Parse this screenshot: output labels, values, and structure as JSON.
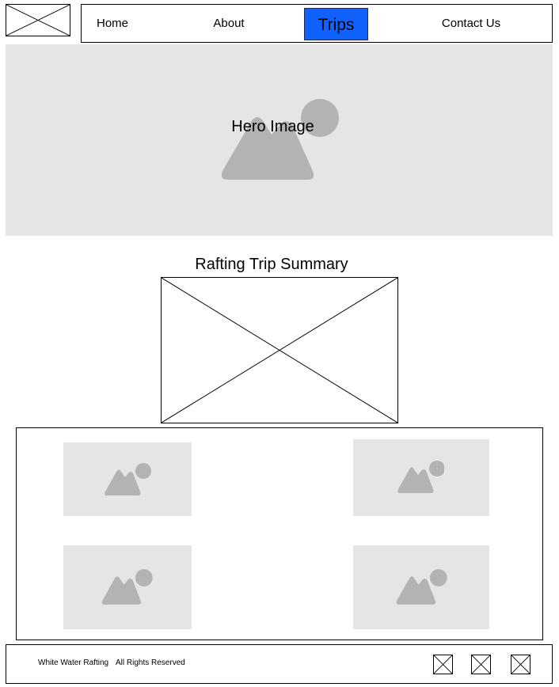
{
  "nav": {
    "items": [
      {
        "label": "Home"
      },
      {
        "label": "About"
      },
      {
        "label": "Trips",
        "active": true
      },
      {
        "label": "Contact Us"
      }
    ],
    "active_color": "#0f62fe"
  },
  "hero": {
    "label": "Hero Image",
    "icon": "image-placeholder-icon"
  },
  "summary": {
    "title": "Rafting Trip Summary",
    "icon": "image-placeholder-x"
  },
  "gallery": {
    "items": [
      {
        "icon": "image-placeholder-icon"
      },
      {
        "icon": "image-placeholder-icon"
      },
      {
        "icon": "image-placeholder-icon"
      },
      {
        "icon": "image-placeholder-icon"
      }
    ]
  },
  "footer": {
    "brand": "White Water Rafting",
    "rights": "All Rights Reserved",
    "social_icons": [
      "social-icon-1",
      "social-icon-2",
      "social-icon-3"
    ]
  },
  "colors": {
    "placeholder_bg": "#e5e5e5",
    "placeholder_shape": "#b3b3b3"
  }
}
